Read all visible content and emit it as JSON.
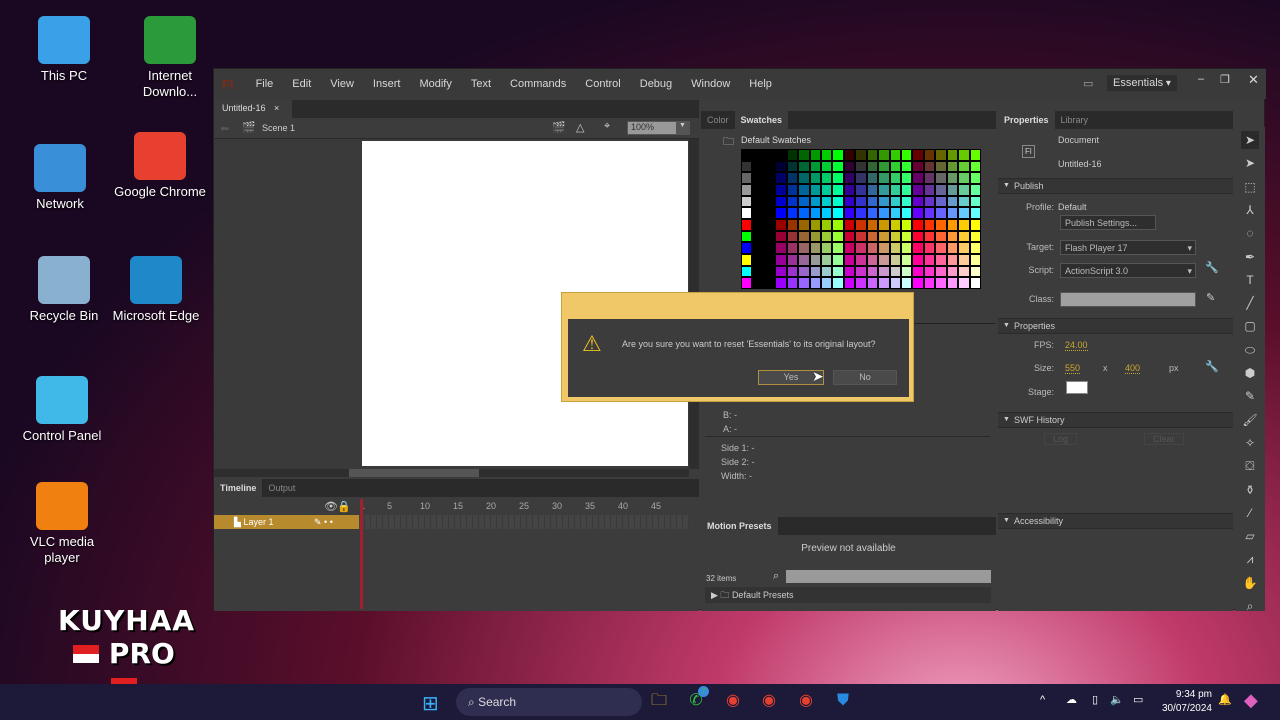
{
  "desktop": {
    "icons": [
      {
        "label": "This PC",
        "name": "this-pc-icon",
        "color": "#3aa0e8"
      },
      {
        "label": "Internet Downlo...",
        "name": "internet-download-manager-icon",
        "color": "#2a9a3a"
      },
      {
        "label": "Network",
        "name": "network-icon",
        "color": "#3a90d8"
      },
      {
        "label": "Google Chrome",
        "name": "chrome-icon",
        "color": "#e84030"
      },
      {
        "label": "Recycle Bin",
        "name": "recycle-bin-icon",
        "color": "#8ab0d0"
      },
      {
        "label": "Microsoft Edge",
        "name": "edge-icon",
        "color": "#1e88c8"
      },
      {
        "label": "Control Panel",
        "name": "control-panel-icon",
        "color": "#40b8e8"
      },
      {
        "label": "VLC media player",
        "name": "vlc-icon",
        "color": "#f08010"
      }
    ],
    "watermark": {
      "line1": "KUYHAA",
      "line2": "PRO"
    }
  },
  "app": {
    "logo": "Fl",
    "menu": [
      "File",
      "Edit",
      "View",
      "Insert",
      "Modify",
      "Text",
      "Commands",
      "Control",
      "Debug",
      "Window",
      "Help"
    ],
    "workspace": "Essentials",
    "doc_tab": "Untitled-16",
    "scene": "Scene 1",
    "zoom": "100%"
  },
  "timeline": {
    "tabs": [
      "Timeline",
      "Output"
    ],
    "frames": [
      "1",
      "5",
      "10",
      "15",
      "20",
      "25",
      "30",
      "35",
      "40",
      "45"
    ],
    "layer": "Layer 1"
  },
  "swatches": {
    "tabs": [
      "Color",
      "Swatches"
    ],
    "folder": "Default Swatches"
  },
  "color_info": {
    "b": "B:",
    "a": "A:",
    "side1": "Side 1:",
    "side2": "Side 2:",
    "width": "Width:",
    "dash": "-"
  },
  "motion": {
    "title": "Motion Presets",
    "preview": "Preview not available",
    "count": "32 items",
    "folder": "Default Presets"
  },
  "properties": {
    "tabs": [
      "Properties",
      "Library"
    ],
    "doc_type": "Document",
    "doc_name": "Untitled-16",
    "publish": "Publish",
    "profile_label": "Profile:",
    "profile": "Default",
    "publish_settings": "Publish Settings...",
    "target_label": "Target:",
    "target": "Flash Player 17",
    "script_label": "Script:",
    "script": "ActionScript 3.0",
    "class_label": "Class:",
    "props": "Properties",
    "fps_label": "FPS:",
    "fps": "24.00",
    "size_label": "Size:",
    "width": "550",
    "x": "x",
    "height": "400",
    "px": "px",
    "stage_label": "Stage:",
    "swf": "SWF History",
    "log": "Log",
    "clear": "Clear",
    "accessibility": "Accessibility"
  },
  "dialog": {
    "message": "Are you sure you want to reset 'Essentials' to its original layout?",
    "yes": "Yes",
    "no": "No"
  },
  "taskbar": {
    "search": "Search",
    "time": "9:34 pm",
    "date": "30/07/2024",
    "whatsapp_badge": "7"
  }
}
